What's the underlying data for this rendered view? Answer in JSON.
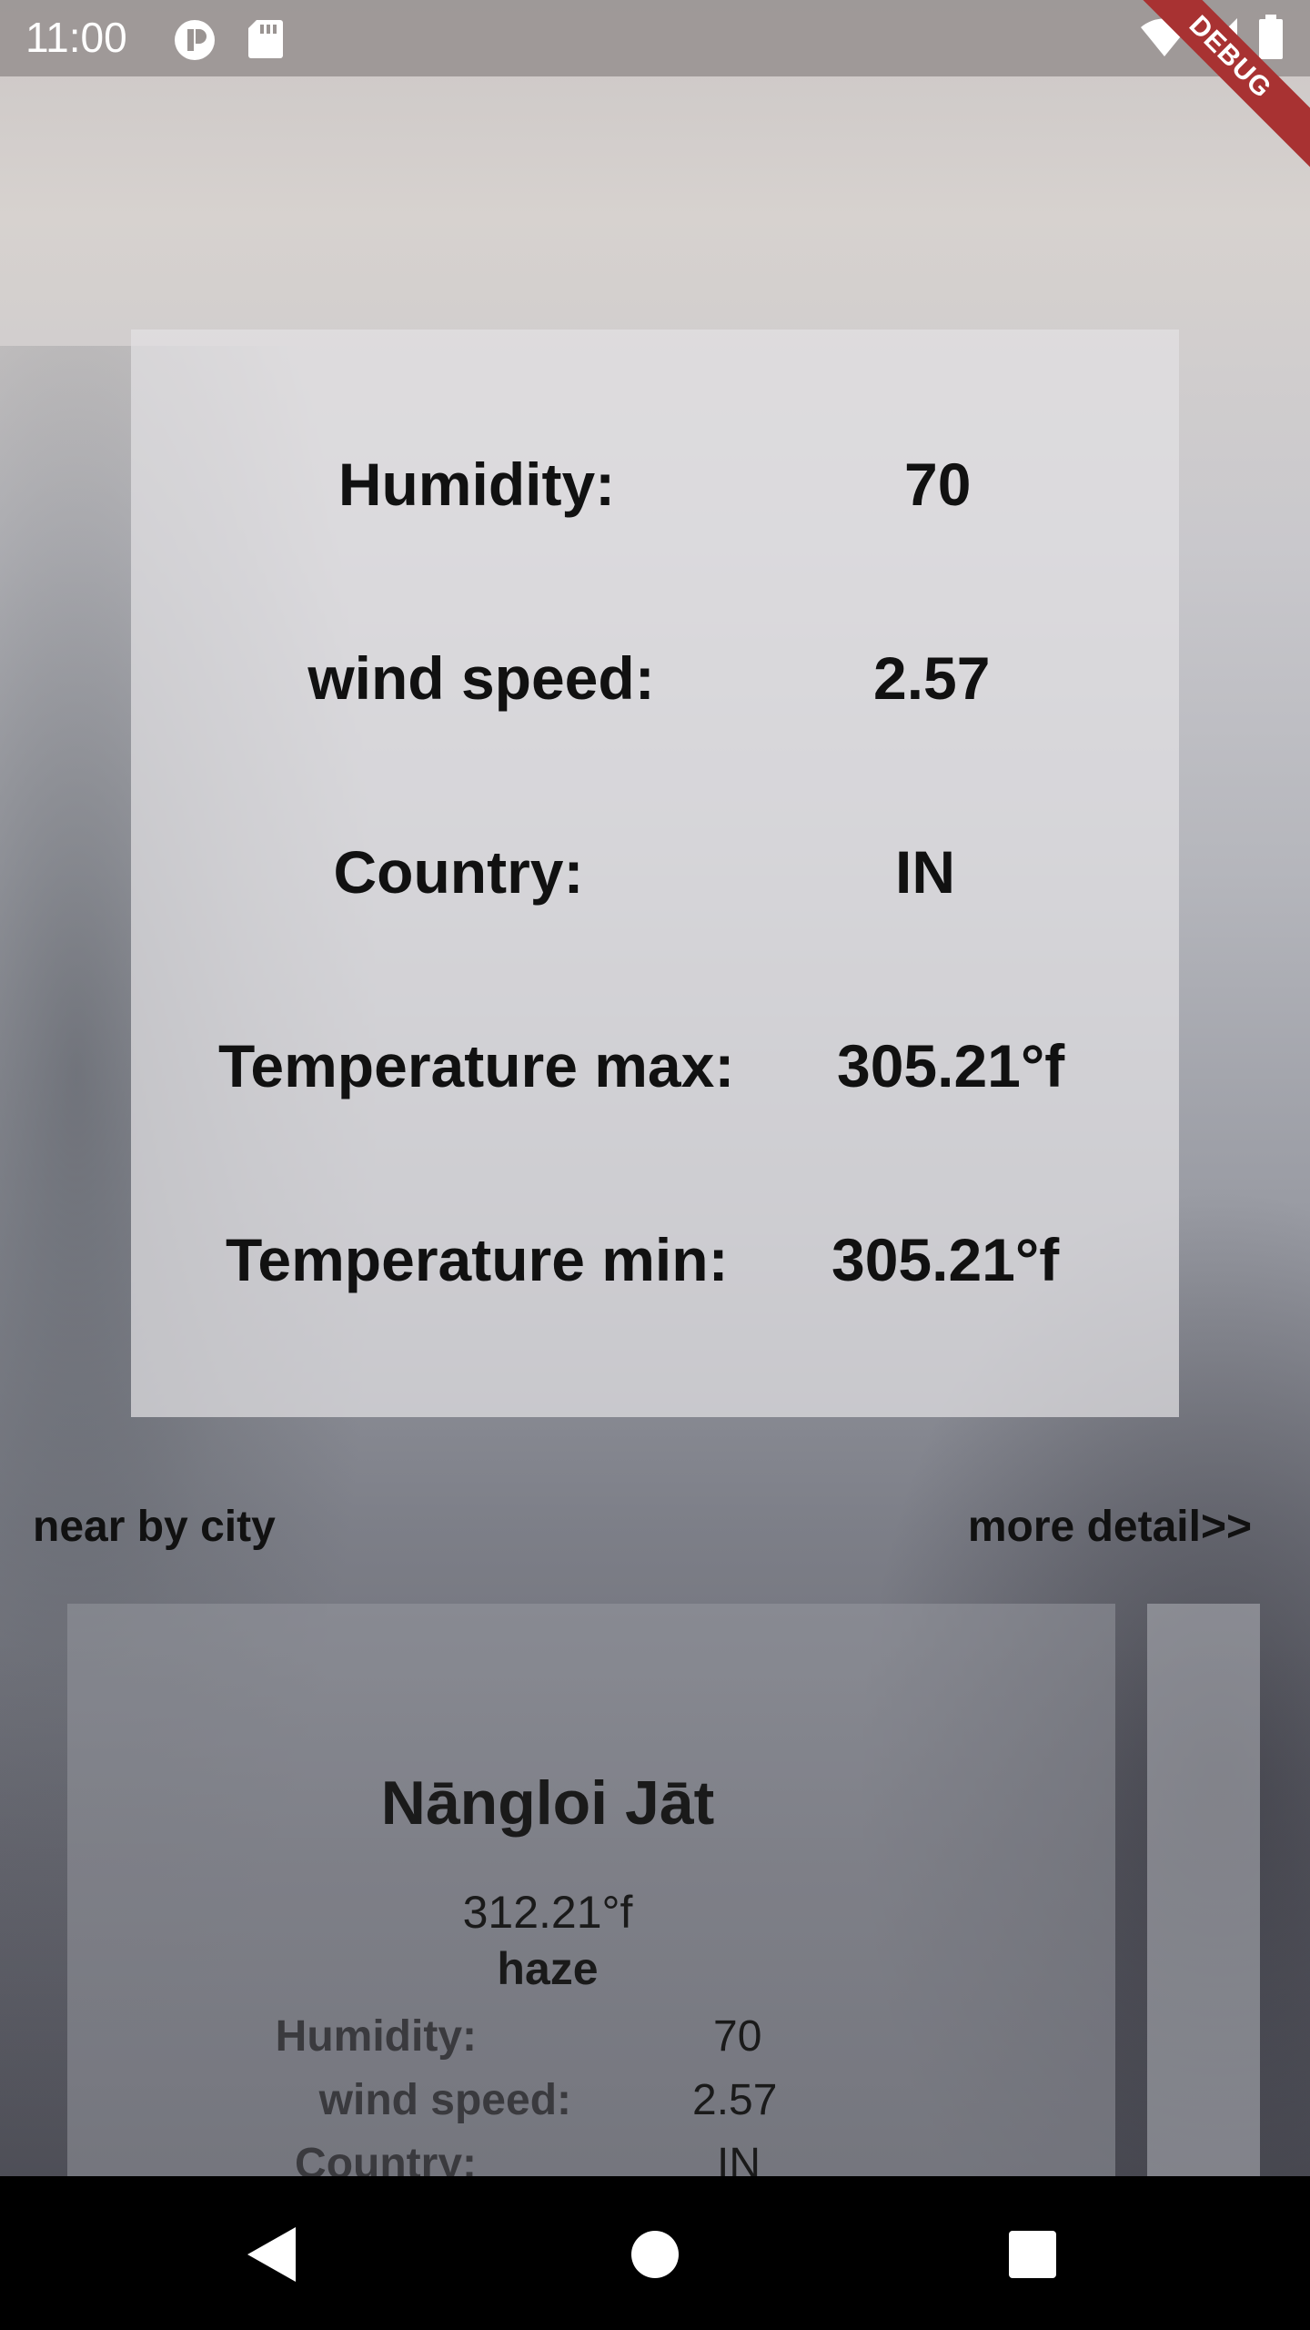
{
  "status_bar": {
    "time": "11:00",
    "icons": [
      "app-notification-icon",
      "sd-card-icon",
      "wifi-icon",
      "signal-icon",
      "battery-icon"
    ],
    "debug_label": "DEBUG"
  },
  "main_card": {
    "rows": [
      {
        "label": "Humidity:",
        "value": "70"
      },
      {
        "label": "wind speed:",
        "value": "2.57"
      },
      {
        "label": "Country:",
        "value": "IN"
      },
      {
        "label": "Temperature max:",
        "value": "305.21°f"
      },
      {
        "label": "Temperature min:",
        "value": "305.21°f"
      }
    ]
  },
  "nearby": {
    "title": "near by city",
    "more_link": "more detail>>"
  },
  "city_cards": [
    {
      "name": "Nāngloi Jāt",
      "temperature": "312.21°f",
      "description": "haze",
      "rows": [
        {
          "label": "Humidity:",
          "value": "70"
        },
        {
          "label": "wind speed:",
          "value": "2.57"
        },
        {
          "label": "Country:",
          "value": "IN"
        }
      ]
    }
  ],
  "nav_bar": {
    "icons": [
      "back-icon",
      "home-icon",
      "recents-icon"
    ]
  },
  "colors": {
    "debug_banner": "#a83232",
    "text": "#111111"
  }
}
